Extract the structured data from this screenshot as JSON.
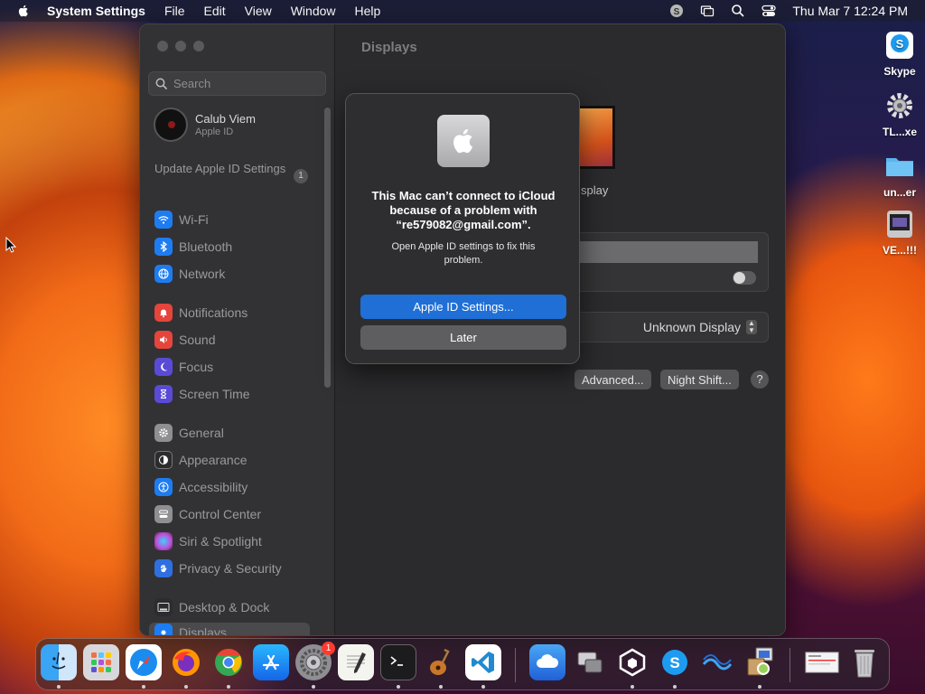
{
  "menubar": {
    "app_name": "System Settings",
    "menus": [
      "File",
      "Edit",
      "View",
      "Window",
      "Help"
    ],
    "clock": "Thu Mar 7  12:24 PM"
  },
  "desktop_icons": [
    {
      "label": "Skype"
    },
    {
      "label": "TL...xe"
    },
    {
      "label": "un...er"
    },
    {
      "label": "VE...!!!"
    }
  ],
  "sidebar": {
    "search_placeholder": "Search",
    "account": {
      "name": "Calub Viem",
      "subtitle": "Apple ID"
    },
    "update": {
      "label": "Update Apple ID Settings",
      "badge": "1"
    },
    "items": [
      {
        "label": "Wi-Fi",
        "color": "#1e7cf2"
      },
      {
        "label": "Bluetooth",
        "color": "#1e7cf2"
      },
      {
        "label": "Network",
        "color": "#1e7cf2"
      },
      {
        "label": "Notifications",
        "color": "#e5453b"
      },
      {
        "label": "Sound",
        "color": "#e5453b"
      },
      {
        "label": "Focus",
        "color": "#5a4bd6"
      },
      {
        "label": "Screen Time",
        "color": "#5a4bd6"
      },
      {
        "label": "General",
        "color": "#8e8e93"
      },
      {
        "label": "Appearance",
        "color": "#2c2c2e"
      },
      {
        "label": "Accessibility",
        "color": "#1e7cf2"
      },
      {
        "label": "Control Center",
        "color": "#8e8e93"
      },
      {
        "label": "Siri & Spotlight",
        "color": "#c24bd6"
      },
      {
        "label": "Privacy & Security",
        "color": "#2f6fe0"
      },
      {
        "label": "Desktop & Dock",
        "color": "#2c2c2e"
      },
      {
        "label": "Displays",
        "color": "#1e7cf2"
      }
    ]
  },
  "main": {
    "title": "Displays",
    "display_label": "splay",
    "display_select": "Unknown Display",
    "advanced_button": "Advanced...",
    "night_shift_button": "Night Shift...",
    "help_button": "?"
  },
  "dialog": {
    "message": "This Mac can’t connect to iCloud because of a problem with “re579082@gmail.com”.",
    "info": "Open Apple ID settings to fix this problem.",
    "primary_button": "Apple ID Settings...",
    "secondary_button": "Later"
  },
  "dock": {
    "settings_badge": "1",
    "apps": [
      "finder-icon",
      "launchpad-icon",
      "safari-icon",
      "firefox-icon",
      "chrome-icon",
      "app-store-icon",
      "system-settings-icon",
      "textedit-icon",
      "terminal-icon",
      "garageband-icon",
      "vscode-icon",
      "icloud-icon",
      "migration-icon",
      "unity-icon",
      "skype-icon",
      "network-icon",
      "installer-icon",
      "document-icon",
      "trash-icon"
    ]
  }
}
